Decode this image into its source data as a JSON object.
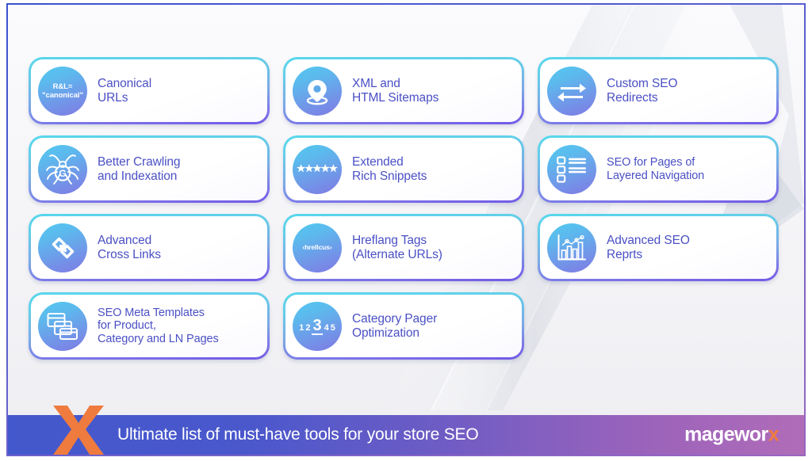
{
  "slide": {
    "background_top": "#fbfbfd",
    "background_bottom": "#eeeef2",
    "frame_color": "#4a56c8"
  },
  "theme": {
    "card_border_top": "#57d7ec",
    "card_border_bottom": "#7059e6",
    "label_color": "#4b50c4",
    "icon_gradient_start": "#53c9ef",
    "icon_gradient_end": "#8079e4",
    "footer_gradient_start": "#4358cc",
    "footer_gradient_end": "#b06cb8",
    "accent_orange": "#ef7b3f"
  },
  "cards": [
    {
      "id": "canonical-urls",
      "label": "Canonical\nURLs",
      "icon": "canonical-tag-icon",
      "icon_text": "R&L=\n\"canonical\""
    },
    {
      "id": "xml-html-sitemaps",
      "label": "XML and\nHTML Sitemaps",
      "icon": "map-pin-icon"
    },
    {
      "id": "custom-seo-redirects",
      "label": "Custom SEO\nRedirects",
      "icon": "redirect-arrows-icon"
    },
    {
      "id": "better-crawling-indexation",
      "label": "Better Crawling\nand Indexation",
      "icon": "crawler-spider-icon",
      "icon_text": "G"
    },
    {
      "id": "extended-rich-snippets",
      "label": "Extended\nRich Snippets",
      "icon": "five-stars-icon",
      "stars": 5
    },
    {
      "id": "seo-layered-navigation",
      "label": "SEO for Pages of\nLayered Navigation",
      "icon": "checklist-icon"
    },
    {
      "id": "advanced-cross-links",
      "label": "Advanced\nCross Links",
      "icon": "chain-link-icon"
    },
    {
      "id": "hreflang-tags",
      "label": "Hreflang Tags\n(Alternate URLs)",
      "icon": "hreflang-code-icon",
      "icon_text": "‹hrellcus›"
    },
    {
      "id": "advanced-seo-reprts",
      "label": "Advanced SEO\nReprts",
      "icon": "bar-chart-icon"
    },
    {
      "id": "seo-meta-templates",
      "label": "SEO Meta Templates\nfor Product,\nCategory and LN Pages",
      "icon": "page-templates-icon"
    },
    {
      "id": "category-pager-optimization",
      "label": "Category Pager\nOptimization",
      "icon": "pagination-icon",
      "pager": [
        "1",
        "2",
        "3",
        "4",
        "5"
      ],
      "pager_current": "3"
    }
  ],
  "footer": {
    "title": "Ultimate list of must-have tools for your store SEO",
    "brand_main": "mageworx",
    "brand_prefix": "magewor",
    "brand_accent": "x",
    "mark": "x-mark-icon"
  }
}
